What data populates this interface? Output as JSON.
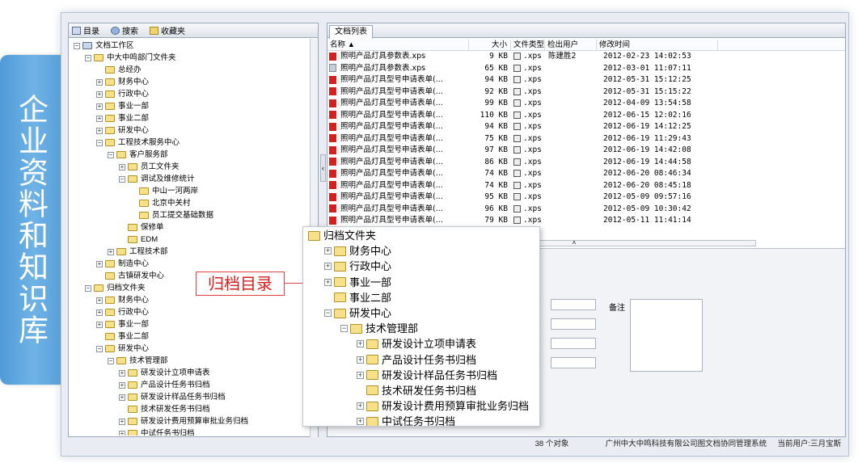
{
  "banner": {
    "text": "企业资料和知识库"
  },
  "left_tabs": [
    {
      "label": "目录",
      "icon": "directory-icon"
    },
    {
      "label": "搜索",
      "icon": "search-icon"
    },
    {
      "label": "收藏夹",
      "icon": "favorites-icon"
    }
  ],
  "tree": [
    {
      "label": "文档工作区",
      "level": 0,
      "toggle": "-",
      "icon": "desk"
    },
    {
      "label": "中大中鸣部门文件夹",
      "level": 1,
      "toggle": "-"
    },
    {
      "label": "总经办",
      "level": 2,
      "toggle": ""
    },
    {
      "label": "财务中心",
      "level": 2,
      "toggle": "+"
    },
    {
      "label": "行政中心",
      "level": 2,
      "toggle": "+"
    },
    {
      "label": "事业一部",
      "level": 2,
      "toggle": "+"
    },
    {
      "label": "事业二部",
      "level": 2,
      "toggle": "+"
    },
    {
      "label": "研发中心",
      "level": 2,
      "toggle": "+"
    },
    {
      "label": "工程技术服务中心",
      "level": 2,
      "toggle": "-"
    },
    {
      "label": "客户服务部",
      "level": 3,
      "toggle": "-"
    },
    {
      "label": "员工文件夹",
      "level": 4,
      "toggle": "+"
    },
    {
      "label": "调试及维修统计",
      "level": 4,
      "toggle": "-"
    },
    {
      "label": "中山一河两岸",
      "level": 5,
      "toggle": ""
    },
    {
      "label": "北京中关村",
      "level": 5,
      "toggle": ""
    },
    {
      "label": "员工提交基础数据",
      "level": 5,
      "toggle": ""
    },
    {
      "label": "保修单",
      "level": 4,
      "toggle": ""
    },
    {
      "label": "EDM",
      "level": 4,
      "toggle": ""
    },
    {
      "label": "工程技术部",
      "level": 3,
      "toggle": "+"
    },
    {
      "label": "制造中心",
      "level": 2,
      "toggle": "+"
    },
    {
      "label": "古镇研发中心",
      "level": 2,
      "toggle": ""
    },
    {
      "label": "归档文件夹",
      "level": 1,
      "toggle": "-"
    },
    {
      "label": "财务中心",
      "level": 2,
      "toggle": "+"
    },
    {
      "label": "行政中心",
      "level": 2,
      "toggle": "+"
    },
    {
      "label": "事业一部",
      "level": 2,
      "toggle": "+"
    },
    {
      "label": "事业二部",
      "level": 2,
      "toggle": ""
    },
    {
      "label": "研发中心",
      "level": 2,
      "toggle": "-"
    },
    {
      "label": "技术管理部",
      "level": 3,
      "toggle": "-"
    },
    {
      "label": "研发设计立项申请表",
      "level": 4,
      "toggle": "+"
    },
    {
      "label": "产品设计任务书归档",
      "level": 4,
      "toggle": "+"
    },
    {
      "label": "研发设计样品任务书归档",
      "level": 4,
      "toggle": "+"
    },
    {
      "label": "技术研发任务书归档",
      "level": 4,
      "toggle": ""
    },
    {
      "label": "研发设计费用预算审批业务归档",
      "level": 4,
      "toggle": "+"
    },
    {
      "label": "中试任务书归档",
      "level": 4,
      "toggle": "+"
    }
  ],
  "right_tab": "文档列表",
  "columns": [
    "名称",
    "大小",
    "文件类型",
    "检出用户",
    "修改时间"
  ],
  "files": [
    {
      "name": "照明产品灯具参数表.xps",
      "size": "9 KB",
      "type": ".xps",
      "user": "陈建胜2",
      "time": "2012-02-23 14:02:53",
      "icon": "red"
    },
    {
      "name": "照明产品灯具参数表.xps",
      "size": "65 KB",
      "type": ".xps",
      "user": "",
      "time": "2012-03-01 11:07:11",
      "icon": "doc"
    },
    {
      "name": "照明产品灯具型号申请表单(...",
      "size": "94 KB",
      "type": ".xps",
      "user": "",
      "time": "2012-05-31 15:12:25",
      "icon": "red"
    },
    {
      "name": "照明产品灯具型号申请表单(...",
      "size": "92 KB",
      "type": ".xps",
      "user": "",
      "time": "2012-05-31 15:15:22",
      "icon": "red"
    },
    {
      "name": "照明产品灯具型号申请表单(...",
      "size": "99 KB",
      "type": ".xps",
      "user": "",
      "time": "2012-04-09 13:54:58",
      "icon": "red"
    },
    {
      "name": "照明产品灯具型号申请表单(...",
      "size": "110 KB",
      "type": ".xps",
      "user": "",
      "time": "2012-06-15 12:02:16",
      "icon": "red"
    },
    {
      "name": "照明产品灯具型号申请表单(...",
      "size": "94 KB",
      "type": ".xps",
      "user": "",
      "time": "2012-06-19 14:12:25",
      "icon": "red"
    },
    {
      "name": "照明产品灯具型号申请表单(...",
      "size": "75 KB",
      "type": ".xps",
      "user": "",
      "time": "2012-06-19 11:29:43",
      "icon": "red"
    },
    {
      "name": "照明产品灯具型号申请表单(...",
      "size": "97 KB",
      "type": ".xps",
      "user": "",
      "time": "2012-06-19 14:42:08",
      "icon": "red"
    },
    {
      "name": "照明产品灯具型号申请表单(...",
      "size": "86 KB",
      "type": ".xps",
      "user": "",
      "time": "2012-06-19 14:44:58",
      "icon": "red"
    },
    {
      "name": "照明产品灯具型号申请表单(...",
      "size": "74 KB",
      "type": ".xps",
      "user": "",
      "time": "2012-06-20 08:46:34",
      "icon": "red"
    },
    {
      "name": "照明产品灯具型号申请表单(...",
      "size": "74 KB",
      "type": ".xps",
      "user": "",
      "time": "2012-06-20 08:45:18",
      "icon": "red"
    },
    {
      "name": "照明产品灯具型号申请表单(...",
      "size": "95 KB",
      "type": ".xps",
      "user": "",
      "time": "2012-05-09 09:57:16",
      "icon": "red"
    },
    {
      "name": "照明产品灯具型号申请表单(...",
      "size": "96 KB",
      "type": ".xps",
      "user": "",
      "time": "2012-05-09 10:30:42",
      "icon": "red"
    },
    {
      "name": "照明产品灯具型号申请表单(...",
      "size": "79 KB",
      "type": ".xps",
      "user": "",
      "time": "2012-05-11 11:41:14",
      "icon": "red"
    }
  ],
  "detail": {
    "remark_label": "备注"
  },
  "status": {
    "count": "38 个对象",
    "company": "广州中大中鸣科技有限公司图文档协同管理系统",
    "user": "当前用户:三月宝斯"
  },
  "callout": "归档目录",
  "popup_tree": [
    {
      "label": "归档文件夹",
      "level": 0,
      "toggle": ""
    },
    {
      "label": "财务中心",
      "level": 1,
      "toggle": "+"
    },
    {
      "label": "行政中心",
      "level": 1,
      "toggle": "+"
    },
    {
      "label": "事业一部",
      "level": 1,
      "toggle": "+"
    },
    {
      "label": "事业二部",
      "level": 1,
      "toggle": ""
    },
    {
      "label": "研发中心",
      "level": 1,
      "toggle": "-"
    },
    {
      "label": "技术管理部",
      "level": 2,
      "toggle": "-"
    },
    {
      "label": "研发设计立项申请表",
      "level": 3,
      "toggle": "+"
    },
    {
      "label": "产品设计任务书归档",
      "level": 3,
      "toggle": "+"
    },
    {
      "label": "研发设计样品任务书归档",
      "level": 3,
      "toggle": "+"
    },
    {
      "label": "技术研发任务书归档",
      "level": 3,
      "toggle": ""
    },
    {
      "label": "研发设计费用预算审批业务归档",
      "level": 3,
      "toggle": "+"
    },
    {
      "label": "中试任务书归档",
      "level": 3,
      "toggle": "+"
    }
  ]
}
